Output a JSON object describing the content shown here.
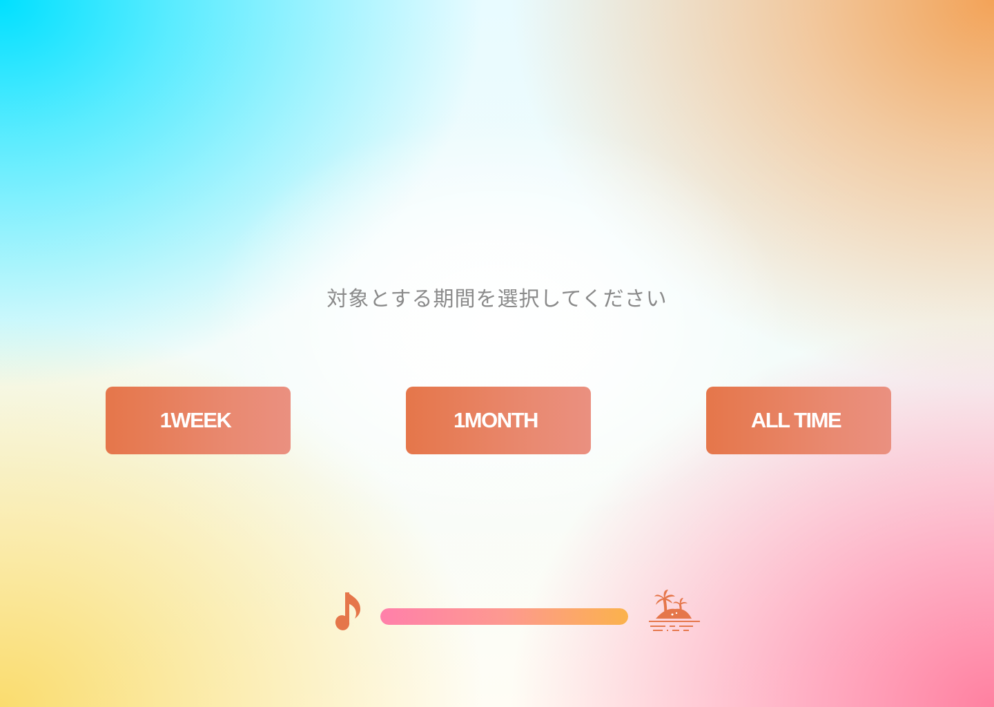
{
  "prompt": {
    "text": "対象とする期間を選択してください"
  },
  "period_buttons": [
    {
      "label": "1WEEK"
    },
    {
      "label": "1MONTH"
    },
    {
      "label": "ALL TIME"
    }
  ],
  "progress": {
    "start_icon": "music-note-icon",
    "end_icon": "island-icon",
    "fill_fraction": 1.0,
    "colors": [
      "#ff80aa",
      "#fbb24c"
    ]
  },
  "colors": {
    "button_start": "#e5764a",
    "button_end": "#ea9080",
    "icon": "#e5764a",
    "prompt_text": "#8a8a8a"
  }
}
